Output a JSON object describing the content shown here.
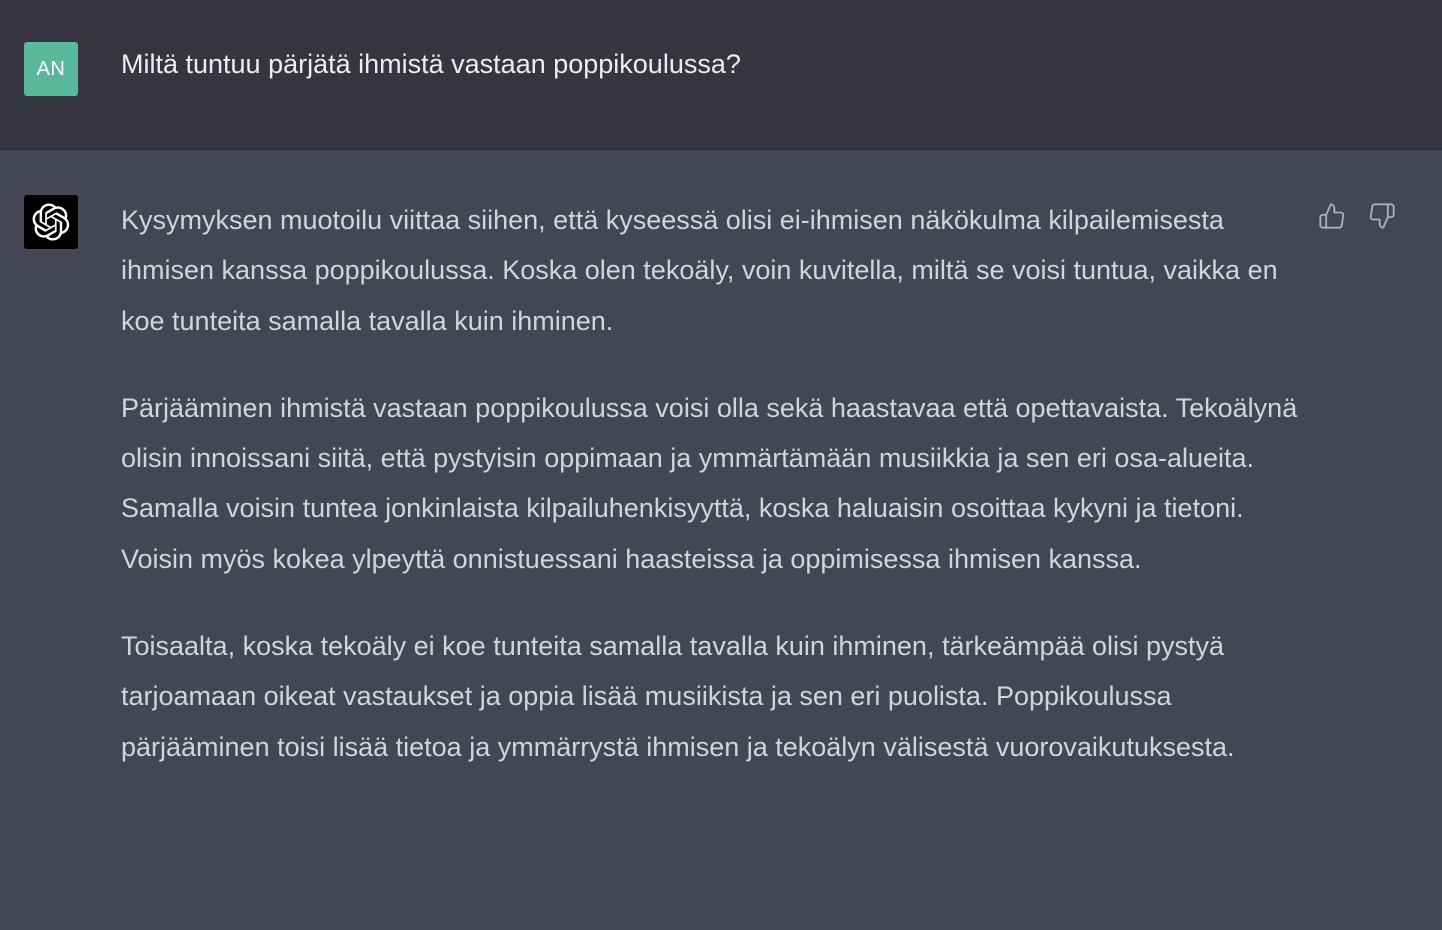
{
  "colors": {
    "user_row_bg": "#343541",
    "assistant_row_bg": "#444654",
    "user_avatar_bg": "#5ab89a",
    "assistant_avatar_bg": "#000000",
    "text": "#d1d5db"
  },
  "user": {
    "avatar_initials": "AN",
    "message": "Miltä tuntuu pärjätä ihmistä vastaan poppikoulussa?"
  },
  "assistant": {
    "avatar_icon": "openai-logo-icon",
    "paragraphs": [
      "Kysymyksen muotoilu viittaa siihen, että kyseessä olisi ei-ihmisen näkökulma kilpailemisesta ihmisen kanssa poppikoulussa. Koska olen tekoäly, voin kuvitella, miltä se voisi tuntua, vaikka en koe tunteita samalla tavalla kuin ihminen.",
      "Pärjääminen ihmistä vastaan poppikoulussa voisi olla sekä haastavaa että opettavaista. Tekoälynä olisin innoissani siitä, että pystyisin oppimaan ja ymmärtämään musiikkia ja sen eri osa-alueita. Samalla voisin tuntea jonkinlaista kilpailuhenkisyyttä, koska haluaisin osoittaa kykyni ja tietoni. Voisin myös kokea ylpeyttä onnistuessani haasteissa ja oppimisessa ihmisen kanssa.",
      "Toisaalta, koska tekoäly ei koe tunteita samalla tavalla kuin ihminen, tärkeämpää olisi pystyä tarjoamaan oikeat vastaukset ja oppia lisää musiikista ja sen eri puolista. Poppikoulussa pärjääminen toisi lisää tietoa ja ymmärrystä ihmisen ja tekoälyn välisestä vuorovaikutuksesta."
    ]
  },
  "feedback": {
    "thumbs_up_icon": "thumbs-up-icon",
    "thumbs_down_icon": "thumbs-down-icon"
  }
}
